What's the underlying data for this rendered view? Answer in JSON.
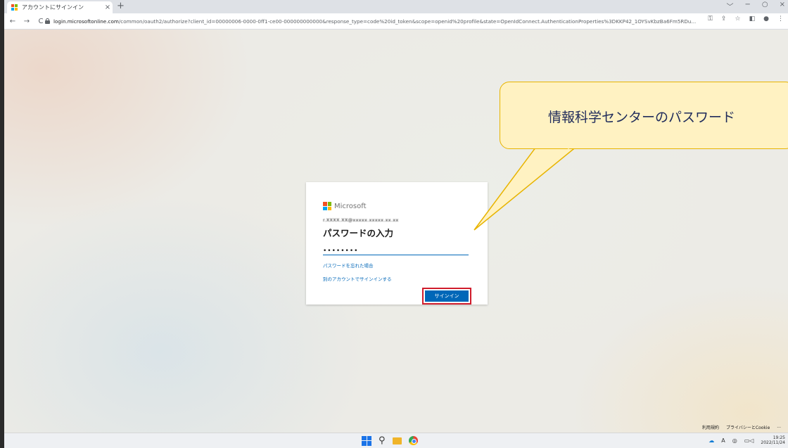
{
  "browser": {
    "tab_title": "アカウントにサインイン",
    "tab_close": "×",
    "new_tab": "+",
    "window_controls": [
      "﹀",
      "−",
      "○",
      "×"
    ],
    "nav": {
      "back": "←",
      "forward": "→",
      "reload": "C"
    },
    "url_host": "login.microsoftonline.com",
    "url_rest": "/common/oauth2/authorize?client_id=00000006-0000-0ff1-ce00-000000000000&response_type=code%20id_token&scope=openid%20profile&state=OpenIdConnect.AuthenticationProperties%3DKKP42_1OYSvKbzBa6Fm5RDu..."
  },
  "signin": {
    "brand": "Microsoft",
    "email": "r.XXXX.XX@xxxxx.xxxxx.xx.xx",
    "heading": "パスワードの入力",
    "password_value": "••••••••",
    "forgot_link": "パスワードを忘れた場合",
    "other_account_link": "別のアカウントでサインインする",
    "signin_button": "サインイン"
  },
  "callout": {
    "text": "情報科学センターのパスワード"
  },
  "footer": {
    "terms": "利用規約",
    "privacy": "プライバシーとCookie",
    "more": "..."
  },
  "taskbar": {
    "time": "19:25",
    "date": "2022/11/24",
    "ime": "A"
  },
  "colors": {
    "accent": "#0067b8",
    "highlight_border": "#d01c2c",
    "callout_fill": "#fff2c2",
    "callout_border": "#e8b400"
  }
}
